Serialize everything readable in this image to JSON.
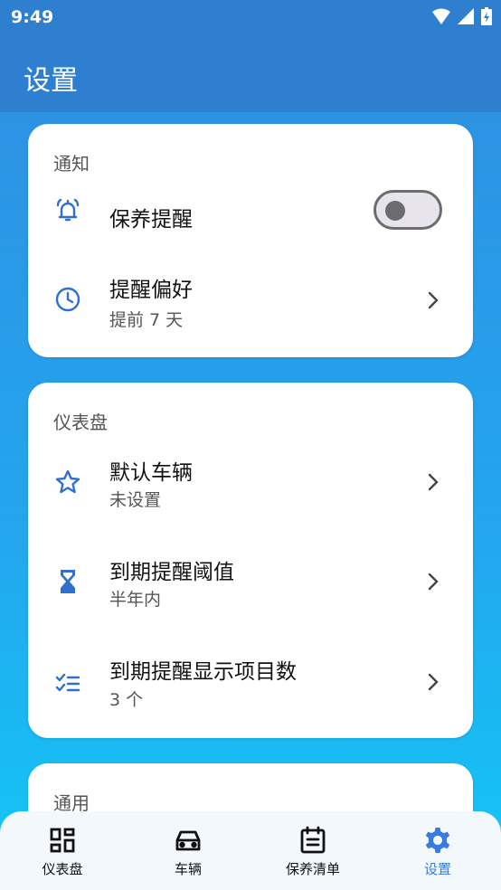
{
  "status_bar": {
    "time": "9:49"
  },
  "app_bar": {
    "title": "设置"
  },
  "notifications": {
    "title": "通知",
    "maintenance_reminder": {
      "label": "保养提醒",
      "toggle_on": false
    },
    "reminder_preference": {
      "label": "提醒偏好",
      "value": "提前 7 天"
    }
  },
  "dashboard": {
    "title": "仪表盘",
    "default_vehicle": {
      "label": "默认车辆",
      "value": "未设置"
    },
    "due_threshold": {
      "label": "到期提醒阈值",
      "value": "半年内"
    },
    "due_display_count": {
      "label": "到期提醒显示项目数",
      "value": "3 个"
    }
  },
  "general": {
    "title": "通用"
  },
  "bottom_nav": {
    "items": [
      {
        "label": "仪表盘",
        "icon": "dashboard-icon"
      },
      {
        "label": "车辆",
        "icon": "car-icon"
      },
      {
        "label": "保养清单",
        "icon": "checklist-icon"
      },
      {
        "label": "设置",
        "icon": "gear-icon",
        "active": true
      }
    ]
  },
  "colors": {
    "accent": "#3a7be0",
    "app_bar": "#2f7fd0"
  }
}
